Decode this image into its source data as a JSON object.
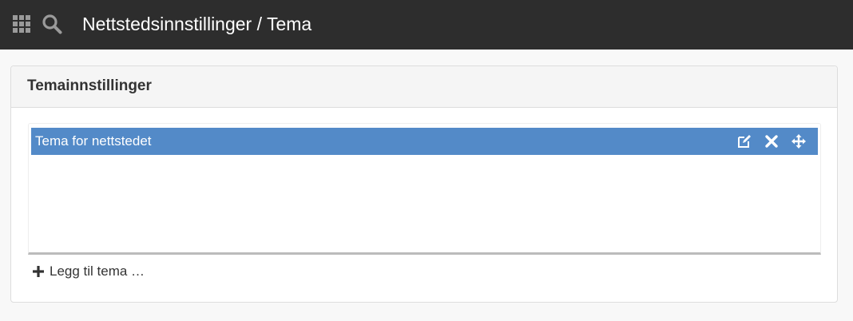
{
  "topbar": {
    "title": "Nettstedsinnstillinger / Tema",
    "icons": [
      "apps-grid-icon",
      "search-icon"
    ],
    "background": "#2d2d2d"
  },
  "panel": {
    "heading": "Temainnstillinger",
    "items": [
      {
        "label": "Tema for nettstedet",
        "actions": [
          "edit-icon",
          "remove-icon",
          "move-icon"
        ]
      }
    ],
    "add_label": "Legg til tema …",
    "item_color": "#538ac8"
  }
}
